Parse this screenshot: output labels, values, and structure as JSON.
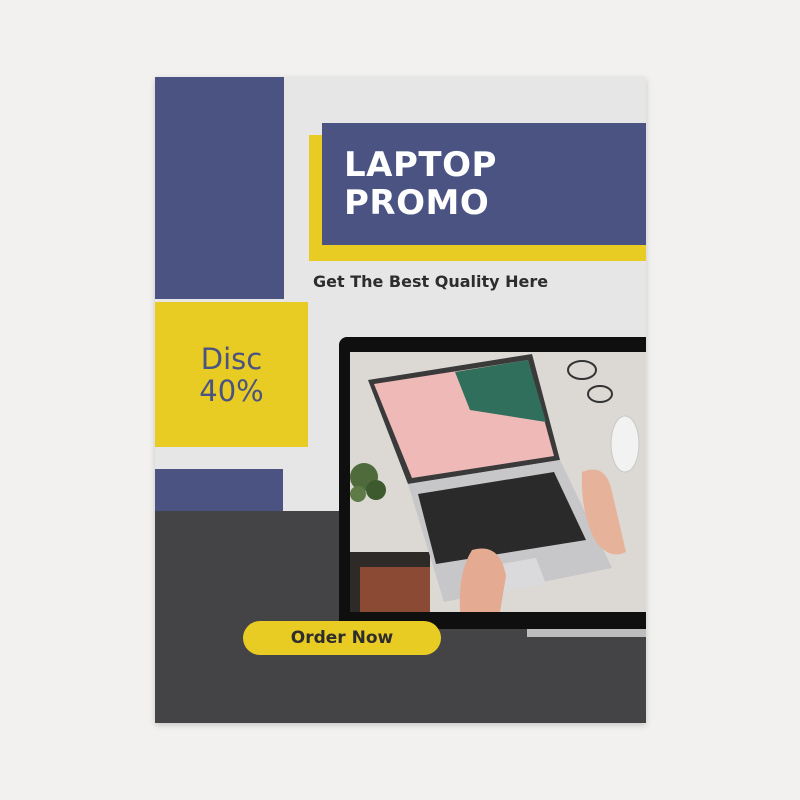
{
  "poster": {
    "title_line1": "LAPTOP",
    "title_line2": "PROMO",
    "subtitle": "Get The Best Quality Here",
    "discount_line1": "Disc",
    "discount_line2": "40%",
    "order_button": "Order Now"
  },
  "colors": {
    "navy": "#4a5382",
    "yellow": "#e8cb23",
    "charcoal": "#444446",
    "paper": "#e6e6e6",
    "background": "#f2f1ef"
  },
  "icons": [
    "laptop-photo",
    "monitor-frame"
  ]
}
